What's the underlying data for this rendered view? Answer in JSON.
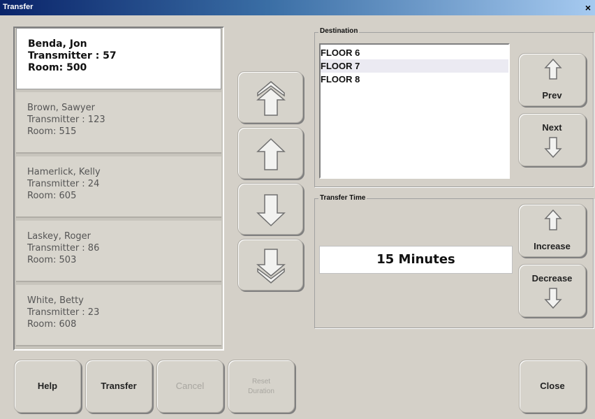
{
  "window": {
    "title": "Transfer",
    "close_glyph": "×"
  },
  "patients": [
    {
      "name": "Benda, Jon",
      "transmitter": "Transmitter : 57",
      "room": "Room: 500",
      "selected": true
    },
    {
      "name": "Brown, Sawyer",
      "transmitter": "Transmitter : 123",
      "room": "Room: 515",
      "selected": false
    },
    {
      "name": "Hamerlick, Kelly",
      "transmitter": "Transmitter : 24",
      "room": "Room: 605",
      "selected": false
    },
    {
      "name": "Laskey, Roger",
      "transmitter": "Transmitter : 86",
      "room": "Room: 503",
      "selected": false
    },
    {
      "name": "White, Betty",
      "transmitter": "Transmitter : 23",
      "room": "Room: 608",
      "selected": false
    }
  ],
  "destination": {
    "label": "Destination",
    "items": [
      "FLOOR 6",
      "FLOOR 7",
      "FLOOR 8"
    ],
    "prev_label": "Prev",
    "next_label": "Next"
  },
  "transfer_time": {
    "label": "Transfer Time",
    "value": "15 Minutes",
    "increase_label": "Increase",
    "decrease_label": "Decrease"
  },
  "buttons": {
    "help": "Help",
    "transfer": "Transfer",
    "cancel": "Cancel",
    "reset_line1": "Reset",
    "reset_line2": "Duration",
    "close": "Close"
  },
  "colors": {
    "titlebar_start": "#0a246a",
    "titlebar_end": "#a6caf0",
    "face": "#d4d0c8"
  }
}
